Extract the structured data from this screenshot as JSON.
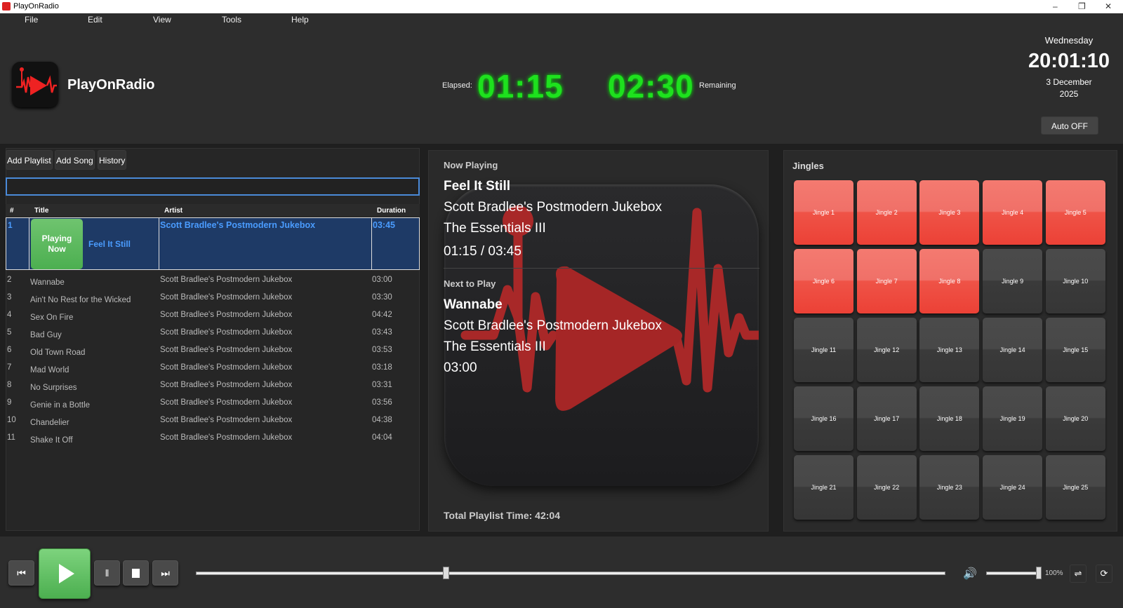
{
  "window": {
    "title": "PlayOnRadio"
  },
  "menu": [
    "File",
    "Edit",
    "View",
    "Tools",
    "Help"
  ],
  "header": {
    "app_name": "PlayOnRadio",
    "elapsed_label": "Elapsed:",
    "elapsed": "01:15",
    "remaining": "02:30",
    "remaining_label": "Remaining",
    "day": "Wednesday",
    "clock": "20:01:10",
    "date": "3 December",
    "year": "2025",
    "auto_button": "Auto OFF"
  },
  "playlist": {
    "buttons": [
      "Add Playlist",
      "Add Song",
      "History"
    ],
    "search_value": "",
    "search_placeholder": "",
    "columns": [
      "#",
      "Title",
      "Artist",
      "Duration"
    ],
    "current": {
      "num": "1",
      "badge_line1": "Playing",
      "badge_line2": "Now",
      "title": "Feel It Still",
      "artist": "Scott Bradlee's Postmodern Jukebox",
      "duration": "03:45"
    },
    "rows": [
      {
        "num": "2",
        "title": "Wannabe",
        "artist": "Scott Bradlee's Postmodern Jukebox",
        "duration": "03:00"
      },
      {
        "num": "3",
        "title": "Ain't No Rest for the Wicked",
        "artist": "Scott Bradlee's Postmodern Jukebox",
        "duration": "03:30"
      },
      {
        "num": "4",
        "title": "Sex On Fire",
        "artist": "Scott Bradlee's Postmodern Jukebox",
        "duration": "04:42"
      },
      {
        "num": "5",
        "title": "Bad Guy",
        "artist": "Scott Bradlee's Postmodern Jukebox",
        "duration": "03:43"
      },
      {
        "num": "6",
        "title": "Old Town Road",
        "artist": "Scott Bradlee's Postmodern Jukebox",
        "duration": "03:53"
      },
      {
        "num": "7",
        "title": "Mad World",
        "artist": "Scott Bradlee's Postmodern Jukebox",
        "duration": "03:18"
      },
      {
        "num": "8",
        "title": "No Surprises",
        "artist": "Scott Bradlee's Postmodern Jukebox",
        "duration": "03:31"
      },
      {
        "num": "9",
        "title": "Genie in a Bottle",
        "artist": "Scott Bradlee's Postmodern Jukebox",
        "duration": "03:56"
      },
      {
        "num": "10",
        "title": "Chandelier",
        "artist": "Scott Bradlee's Postmodern Jukebox",
        "duration": "04:38"
      },
      {
        "num": "11",
        "title": "Shake It Off",
        "artist": "Scott Bradlee's Postmodern Jukebox",
        "duration": "04:04"
      }
    ]
  },
  "now_playing": {
    "heading": "Now Playing",
    "title": "Feel It Still",
    "artist": "Scott Bradlee's Postmodern Jukebox",
    "album": "The Essentials III",
    "time": "01:15 / 03:45",
    "next_heading": "Next to Play",
    "next_title": "Wannabe",
    "next_artist": "Scott Bradlee's Postmodern Jukebox",
    "next_album": "The Essentials III",
    "next_duration": "03:00",
    "total": "Total Playlist Time: 42:04"
  },
  "jingles": {
    "heading": "Jingles",
    "active_color": "#ef5347",
    "inactive_color": "#404040",
    "items": [
      "Jingle 1",
      "Jingle 2",
      "Jingle 3",
      "Jingle 4",
      "Jingle 5",
      "Jingle 6",
      "Jingle 7",
      "Jingle 8",
      "Jingle 9",
      "Jingle 10",
      "Jingle 11",
      "Jingle 12",
      "Jingle 13",
      "Jingle 14",
      "Jingle 15",
      "Jingle 16",
      "Jingle 17",
      "Jingle 18",
      "Jingle 19",
      "Jingle 20",
      "Jingle 21",
      "Jingle 22",
      "Jingle 23",
      "Jingle 24",
      "Jingle 25"
    ],
    "active_count": 8
  },
  "transport": {
    "seek_fraction": 0.333,
    "volume_percent": 100,
    "volume_label": "100%",
    "play_color": "#5cc35c",
    "icons": [
      "previous-icon",
      "play-icon",
      "pause-icon",
      "stop-icon",
      "next-icon",
      "volume-icon",
      "shuffle-icon",
      "repeat-icon"
    ]
  }
}
